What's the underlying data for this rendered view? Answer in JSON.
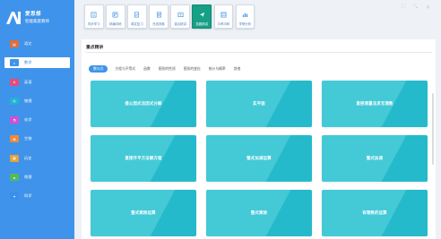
{
  "app": {
    "logo_line1": "爱思想",
    "logo_line2": "智能家庭教师",
    "logo_mark": "AI",
    "accent": "#3f93ea",
    "active_tool_color": "#16a085",
    "card_color": "#29c2d2"
  },
  "sidebar": {
    "items": [
      {
        "label": "语文",
        "icon": "book-icon",
        "color": "#e46b3c"
      },
      {
        "label": "数学",
        "icon": "calculator-icon",
        "color": "#3f93ea",
        "active": true
      },
      {
        "label": "英语",
        "icon": "english-icon",
        "color": "#e84a7a"
      },
      {
        "label": "物理",
        "icon": "physics-icon",
        "color": "#22b3d4"
      },
      {
        "label": "化学",
        "icon": "chemistry-icon",
        "color": "#d64fd0"
      },
      {
        "label": "生物",
        "icon": "biology-icon",
        "color": "#f08a3a"
      },
      {
        "label": "历史",
        "icon": "history-icon",
        "color": "#e6a23c"
      },
      {
        "label": "地理",
        "icon": "globe-icon",
        "color": "#56b85c"
      },
      {
        "label": "科学",
        "icon": "science-icon",
        "color": "#3a8ee8"
      }
    ]
  },
  "toolbar": {
    "items": [
      {
        "label": "同步学习",
        "icon": "sync-study-icon"
      },
      {
        "label": "精编训练",
        "icon": "training-icon"
      },
      {
        "label": "周定复习",
        "icon": "review-icon"
      },
      {
        "label": "在线测卷",
        "icon": "exam-icon"
      },
      {
        "label": "重点精讲",
        "icon": "key-points-icon"
      },
      {
        "label": "答题精讲",
        "icon": "answer-icon",
        "active": true
      },
      {
        "label": "中考冲刺",
        "icon": "sprint-icon"
      },
      {
        "label": "学情分析",
        "icon": "analysis-icon"
      }
    ]
  },
  "main": {
    "section_title": "重点精讲",
    "tabs": [
      "数与式",
      "方程与不等式",
      "函数",
      "图形的性质",
      "图形的变化",
      "统计与概率",
      "其他"
    ],
    "active_tab": 0,
    "cards": [
      "提公因式法因式分解",
      "实平面",
      "直接测量法求无理数",
      "直接开平方法解方程",
      "整式加减运算",
      "整式加减",
      "整式乘除运算",
      "整式乘除",
      "有理数的运算"
    ]
  }
}
